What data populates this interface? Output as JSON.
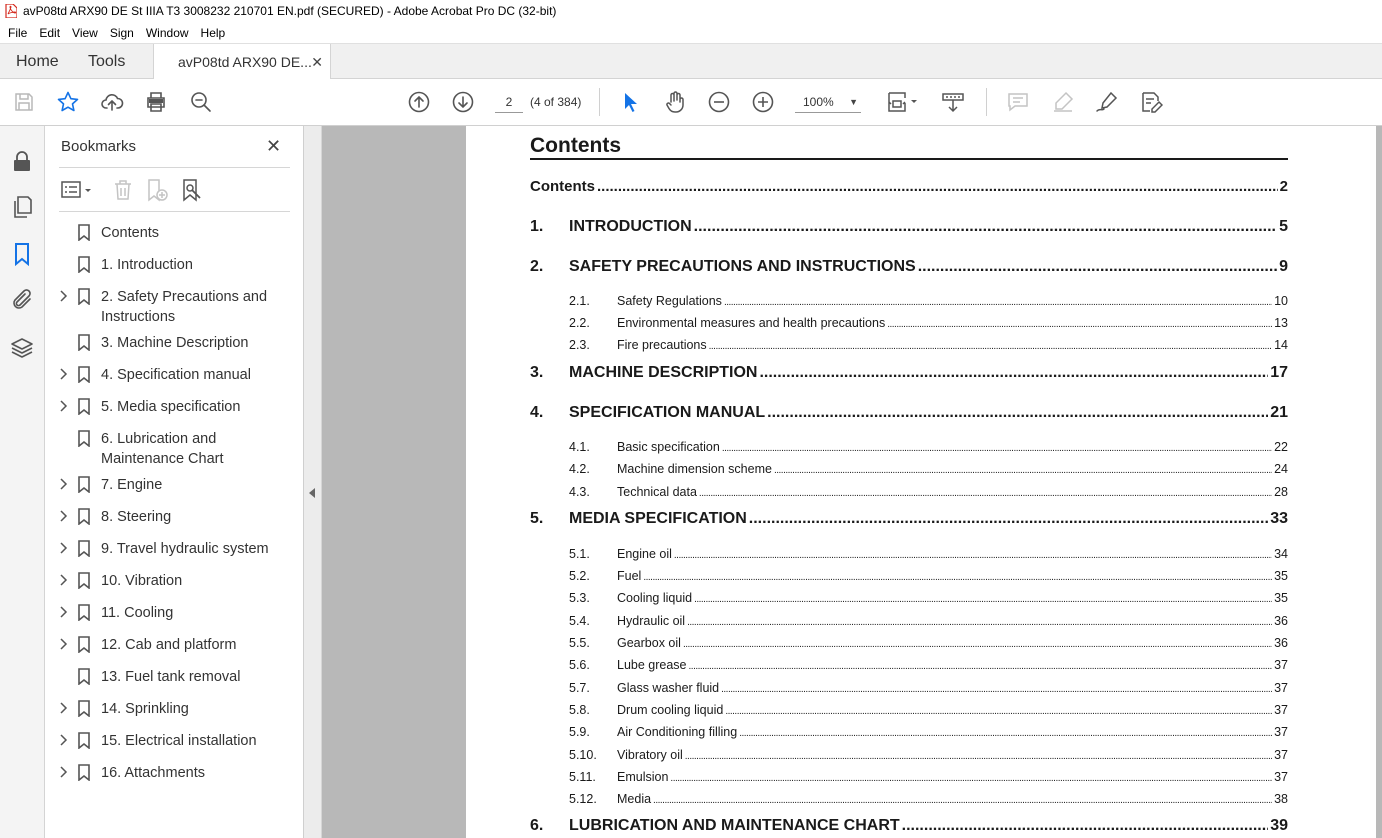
{
  "window": {
    "title": "avP08td ARX90 DE St IIIA T3 3008232 210701 EN.pdf (SECURED) - Adobe Acrobat Pro DC (32-bit)"
  },
  "menu": [
    "File",
    "Edit",
    "View",
    "Sign",
    "Window",
    "Help"
  ],
  "tabs": {
    "home": "Home",
    "tools": "Tools",
    "document": "avP08td ARX90 DE...",
    "close": "✕"
  },
  "toolbar": {
    "page_current": "2",
    "page_count": "(4 of 384)",
    "zoom": "100%",
    "zoom_caret": "▼"
  },
  "bookmarks": {
    "title": "Bookmarks",
    "close": "✕",
    "items": [
      {
        "label": "Contents",
        "expandable": false
      },
      {
        "label": "1. Introduction",
        "expandable": false
      },
      {
        "label": "2. Safety Precautions and Instructions",
        "expandable": true
      },
      {
        "label": "3. Machine Description",
        "expandable": false
      },
      {
        "label": "4. Specification manual",
        "expandable": true
      },
      {
        "label": "5. Media specification",
        "expandable": true
      },
      {
        "label": "6. Lubrication and Maintenance Chart",
        "expandable": false
      },
      {
        "label": "7. Engine",
        "expandable": true
      },
      {
        "label": "8. Steering",
        "expandable": true
      },
      {
        "label": "9. Travel hydraulic system",
        "expandable": true
      },
      {
        "label": "10. Vibration",
        "expandable": true
      },
      {
        "label": "11. Cooling",
        "expandable": true
      },
      {
        "label": "12. Cab and platform",
        "expandable": true
      },
      {
        "label": "13. Fuel tank removal",
        "expandable": false
      },
      {
        "label": "14. Sprinkling",
        "expandable": true
      },
      {
        "label": "15. Electrical installation",
        "expandable": true
      },
      {
        "label": "16. Attachments",
        "expandable": true
      }
    ]
  },
  "document": {
    "heading": "Contents",
    "toc": [
      {
        "level": 0,
        "num": "",
        "name": "Contents",
        "page": "2"
      },
      {
        "level": 1,
        "num": "1.",
        "name": "INTRODUCTION",
        "page": "5"
      },
      {
        "level": 1,
        "num": "2.",
        "name": "SAFETY PRECAUTIONS AND INSTRUCTIONS",
        "page": "9"
      },
      {
        "level": 2,
        "num": "2.1.",
        "name": "Safety Regulations",
        "page": "10"
      },
      {
        "level": 2,
        "num": "2.2.",
        "name": "Environmental measures and health precautions",
        "page": "13"
      },
      {
        "level": 2,
        "num": "2.3.",
        "name": "Fire precautions",
        "page": "14"
      },
      {
        "level": 1,
        "num": "3.",
        "name": "MACHINE DESCRIPTION",
        "page": "17"
      },
      {
        "level": 1,
        "num": "4.",
        "name": "SPECIFICATION MANUAL",
        "page": "21"
      },
      {
        "level": 2,
        "num": "4.1.",
        "name": "Basic specification",
        "page": "22"
      },
      {
        "level": 2,
        "num": "4.2.",
        "name": "Machine dimension scheme",
        "page": "24"
      },
      {
        "level": 2,
        "num": "4.3.",
        "name": "Technical data",
        "page": "28"
      },
      {
        "level": 1,
        "num": "5.",
        "name": "MEDIA SPECIFICATION",
        "page": "33"
      },
      {
        "level": 2,
        "num": "5.1.",
        "name": "Engine oil",
        "page": "34"
      },
      {
        "level": 2,
        "num": "5.2.",
        "name": "Fuel",
        "page": "35"
      },
      {
        "level": 2,
        "num": "5.3.",
        "name": "Cooling liquid",
        "page": "35"
      },
      {
        "level": 2,
        "num": "5.4.",
        "name": "Hydraulic oil",
        "page": "36"
      },
      {
        "level": 2,
        "num": "5.5.",
        "name": "Gearbox oil",
        "page": "36"
      },
      {
        "level": 2,
        "num": "5.6.",
        "name": "Lube grease",
        "page": "37"
      },
      {
        "level": 2,
        "num": "5.7.",
        "name": "Glass washer fluid",
        "page": "37"
      },
      {
        "level": 2,
        "num": "5.8.",
        "name": "Drum cooling liquid",
        "page": "37"
      },
      {
        "level": 2,
        "num": "5.9.",
        "name": "Air Conditioning filling",
        "page": "37"
      },
      {
        "level": 2,
        "num": "5.10.",
        "name": "Vibratory oil",
        "page": "37"
      },
      {
        "level": 2,
        "num": "5.11.",
        "name": "Emulsion",
        "page": "37"
      },
      {
        "level": 2,
        "num": "5.12.",
        "name": "Media",
        "page": "38"
      },
      {
        "level": 1,
        "num": "6.",
        "name": "LUBRICATION AND MAINTENANCE CHART",
        "page": "39"
      }
    ]
  },
  "colors": {
    "accent": "#1473e6",
    "pdf_red": "#d4291d"
  }
}
